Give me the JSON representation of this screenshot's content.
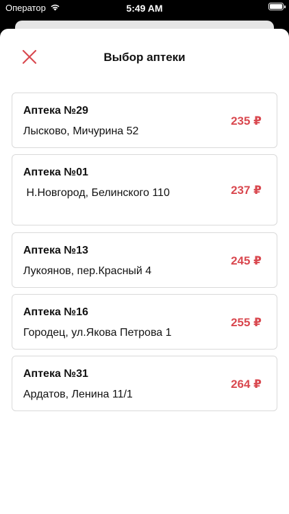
{
  "status_bar": {
    "carrier": "Оператор",
    "time": "5:49 AM"
  },
  "sheet": {
    "title": "Выбор аптеки"
  },
  "colors": {
    "accent": "#d9484f",
    "card_border": "#d9d9d9"
  },
  "pharmacies": [
    {
      "name": "Аптека №29",
      "address": "Лысково, Мичурина 52",
      "price": "235 ₽"
    },
    {
      "name": "Аптека №01",
      "address": " Н.Новгород, Белинского 110",
      "price": "237 ₽"
    },
    {
      "name": "Аптека №13",
      "address": "Лукоянов, пер.Красный 4",
      "price": "245 ₽"
    },
    {
      "name": "Аптека №16",
      "address": "Городец, ул.Якова Петрова 1",
      "price": "255 ₽"
    },
    {
      "name": "Аптека №31",
      "address": "Ардатов, Ленина 11/1",
      "price": "264 ₽"
    }
  ]
}
